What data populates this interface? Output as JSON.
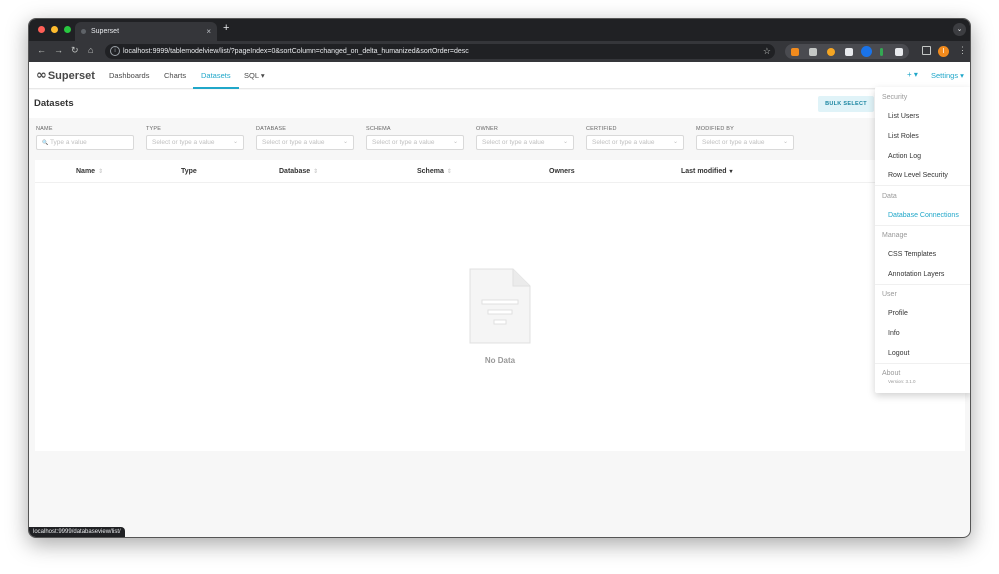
{
  "browser": {
    "tab_title": "Superset",
    "tab_close": "×",
    "new_tab": "+",
    "url": "localhost:9999/tablemodelview/list/?pageIndex=0&sortColumn=changed_on_delta_humanized&sortOrder=desc",
    "status_url": "localhost:9999/databaseview/list/",
    "profile_initial": "I",
    "icons": {
      "back": "←",
      "forward": "→",
      "reload": "↻",
      "home": "⌂",
      "star": "☆",
      "menu": "⋮",
      "tab_menu": "⌄",
      "info": "i"
    },
    "traffic_colors": [
      "#ff5f57",
      "#febc2e",
      "#28c840"
    ],
    "extension_colors": [
      "#f28b1d",
      "#c4c7c5",
      "#f5a623",
      "#e8eaed",
      "#1a73e8",
      "#34a853",
      "#e8eaed"
    ]
  },
  "app": {
    "brand": "Superset",
    "logo_mark": "∞",
    "nav": [
      {
        "label": "Dashboards"
      },
      {
        "label": "Charts"
      },
      {
        "label": "Datasets"
      },
      {
        "label": "SQL ▾"
      }
    ],
    "plus_menu": "+ ▾",
    "settings_menu": "Settings ▾",
    "accent": "#20a7c9"
  },
  "page": {
    "title": "Datasets",
    "bulk_select": "BULK SELECT"
  },
  "filters": [
    {
      "label": "NAME",
      "placeholder": "Type a value",
      "icon": "🔍"
    },
    {
      "label": "TYPE",
      "placeholder": "Select or type a value"
    },
    {
      "label": "DATABASE",
      "placeholder": "Select or type a value"
    },
    {
      "label": "SCHEMA",
      "placeholder": "Select or type a value"
    },
    {
      "label": "OWNER",
      "placeholder": "Select or type a value"
    },
    {
      "label": "CERTIFIED",
      "placeholder": "Select or type a value"
    },
    {
      "label": "MODIFIED BY",
      "placeholder": "Select or type a value"
    }
  ],
  "table": {
    "columns": [
      {
        "label": "Name",
        "sort": "⇕"
      },
      {
        "label": "Type",
        "sort": ""
      },
      {
        "label": "Database",
        "sort": "⇕"
      },
      {
        "label": "Schema",
        "sort": "⇕"
      },
      {
        "label": "Owners",
        "sort": ""
      },
      {
        "label": "Last modified",
        "sort": "▾"
      }
    ],
    "empty_text": "No Data"
  },
  "settings_dropdown": {
    "groups": [
      {
        "title": "Security",
        "items": [
          "List Users",
          "List Roles",
          "Action Log",
          "Row Level Security"
        ]
      },
      {
        "title": "Data",
        "items": [
          "Database Connections"
        ]
      },
      {
        "title": "Manage",
        "items": [
          "CSS Templates",
          "Annotation Layers"
        ]
      },
      {
        "title": "User",
        "items": [
          "Profile",
          "Info",
          "Logout"
        ]
      },
      {
        "title": "About",
        "items": []
      }
    ],
    "version": "Version: 3.1.0"
  }
}
